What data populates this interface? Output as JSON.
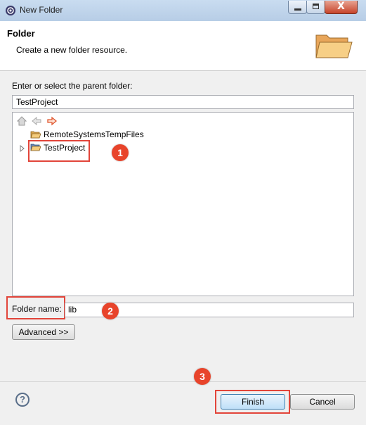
{
  "window": {
    "title": "New Folder",
    "minimize": "minimize",
    "maximize": "maximize",
    "close": "X"
  },
  "header": {
    "title": "Folder",
    "description": "Create a new folder resource."
  },
  "parent": {
    "label": "Enter or select the parent folder:",
    "path_value": "TestProject"
  },
  "tree": {
    "toolbar": [
      "home-icon",
      "back-arrow-icon",
      "forward-arrow-icon"
    ],
    "items": [
      {
        "label": "RemoteSystemsTempFiles",
        "icon": "folder-open-icon"
      },
      {
        "label": "TestProject",
        "icon": "project-folder-icon",
        "selected": true
      }
    ]
  },
  "folder_name": {
    "label": "Folder name:",
    "value": "lib"
  },
  "advanced_label": "Advanced >>",
  "callouts": [
    "1",
    "2",
    "3"
  ],
  "buttons": {
    "help": "?",
    "finish": "Finish",
    "cancel": "Cancel"
  },
  "colors": {
    "callout": "#e8442b",
    "highlight_box": "#e2453a",
    "titlebar": "#c9dcf0"
  }
}
